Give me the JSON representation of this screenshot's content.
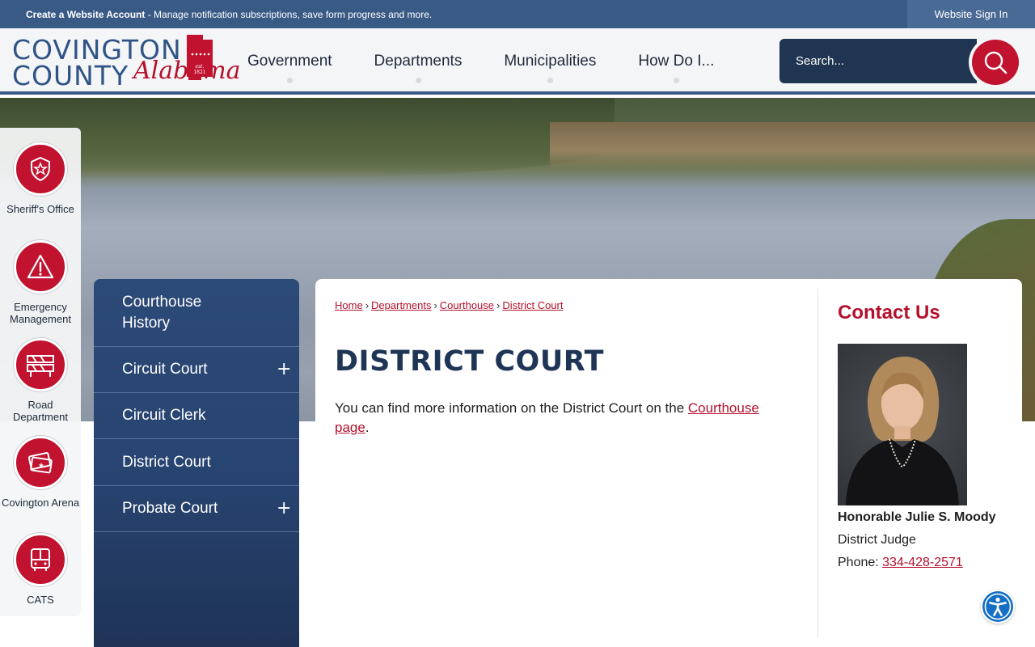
{
  "topbar": {
    "account_link": "Create a Website Account",
    "account_text": " - Manage notification subscriptions, save form progress and more.",
    "signin": "Website Sign In"
  },
  "logo": {
    "line1": "COVINGTON",
    "line2": "COUNTY",
    "script": "Alabama",
    "est": "est.",
    "year": "1821"
  },
  "nav": {
    "items": [
      "Government",
      "Departments",
      "Municipalities",
      "How Do I..."
    ]
  },
  "search": {
    "placeholder": "Search..."
  },
  "quicklinks": {
    "items": [
      {
        "label": "Sheriff's Office"
      },
      {
        "label": "Emergency Management"
      },
      {
        "label": "Road Department"
      },
      {
        "label": "Covington Arena"
      },
      {
        "label": "CATS"
      }
    ]
  },
  "sidenav": {
    "items": [
      {
        "label": "Courthouse History",
        "expandable": false
      },
      {
        "label": "Circuit Court",
        "expandable": true
      },
      {
        "label": "Circuit Clerk",
        "expandable": false
      },
      {
        "label": "District Court",
        "expandable": false
      },
      {
        "label": "Probate Court",
        "expandable": true
      }
    ],
    "expand_symbol": "+"
  },
  "breadcrumb": {
    "items": [
      "Home",
      "Departments",
      "Courthouse",
      "District Court"
    ],
    "separator": "›"
  },
  "page": {
    "title": "DISTRICT COURT",
    "body_prefix": "You can find more information on the District Court on the ",
    "body_link": "Courthouse page",
    "body_suffix": "."
  },
  "contact": {
    "title": "Contact Us",
    "name": "Honorable Julie S. Moody",
    "role": "District Judge",
    "phone_label": "Phone: ",
    "phone": "334-428-2571"
  },
  "colors": {
    "brand_blue": "#3a5a86",
    "accent_red": "#c1122f",
    "dark_navy": "#1f3552"
  },
  "icons": {
    "search": "search-icon",
    "sheriff": "sheriff-badge-icon",
    "emergency": "warning-icon",
    "road": "road-barrier-icon",
    "arena": "tickets-icon",
    "cats": "bus-icon",
    "accessibility": "accessibility-icon"
  }
}
